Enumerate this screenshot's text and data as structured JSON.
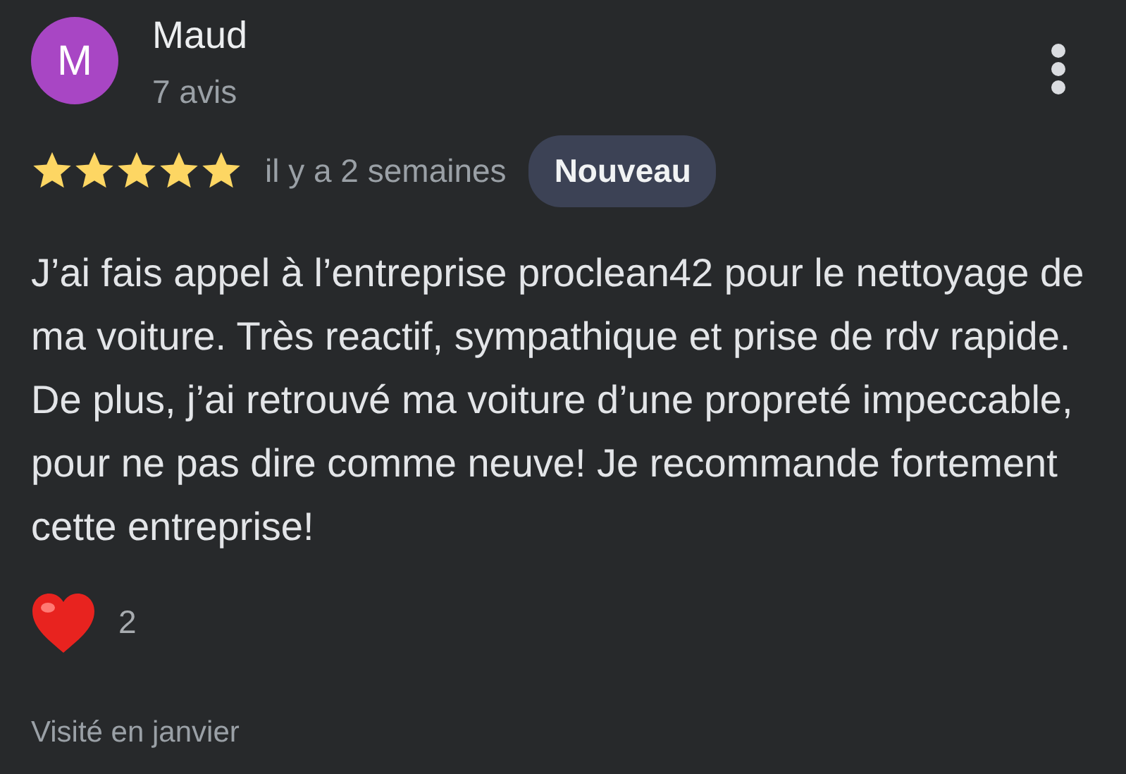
{
  "review": {
    "avatar_letter": "M",
    "author": "Maud",
    "review_count": "7 avis",
    "stars": 5,
    "date": "il y a 2 semaines",
    "badge": "Nouveau",
    "text": "J’ai fais appel à l’entreprise proclean42 pour le nettoyage de ma voiture. Très reactif, sympathique et prise de rdv rapide. De plus, j’ai retrouvé ma voiture d’une propreté impeccable, pour ne pas dire comme neuve! Je recommande fortement cette entreprise!",
    "reactions": "2",
    "visited": "Visité en janvier"
  }
}
